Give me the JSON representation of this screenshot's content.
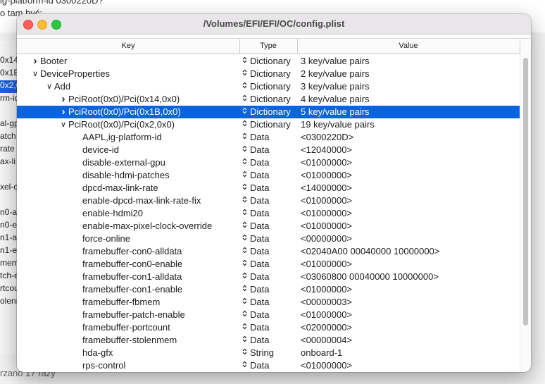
{
  "background": {
    "top_lines": [
      "ig-platform-id 0300220D?",
      "o tam być:"
    ],
    "fragments": [
      "0x14",
      "0x1B",
      "0x2,0",
      "rm-id",
      "",
      "al-gp",
      "atch",
      "rate",
      "ax-li",
      "",
      "xel-c",
      "",
      "n0-a",
      "n0-e",
      "n1-a",
      "n1-e",
      "mem",
      "tch-e",
      "rtcou",
      "olenm"
    ],
    "bottom_text": "rzano 17 razy"
  },
  "window": {
    "title": "/Volumes/EFI/EFI/OC/config.plist",
    "columns": {
      "key": "Key",
      "type": "Type",
      "value": "Value"
    },
    "rows": [
      {
        "key": "Booter",
        "type": "Dictionary",
        "value": "3 key/value pairs",
        "level": 0,
        "disclosure": ">",
        "selected": false
      },
      {
        "key": "DeviceProperties",
        "type": "Dictionary",
        "value": "2 key/value pairs",
        "level": 0,
        "disclosure": "v",
        "selected": false
      },
      {
        "key": "Add",
        "type": "Dictionary",
        "value": "3 key/value pairs",
        "level": 1,
        "disclosure": "v",
        "selected": false
      },
      {
        "key": "PciRoot(0x0)/Pci(0x14,0x0)",
        "type": "Dictionary",
        "value": "4 key/value pairs",
        "level": 2,
        "disclosure": ">",
        "selected": false
      },
      {
        "key": "PciRoot(0x0)/Pci(0x1B,0x0)",
        "type": "Dictionary",
        "value": "5 key/value pairs",
        "level": 2,
        "disclosure": ">",
        "selected": true
      },
      {
        "key": "PciRoot(0x0)/Pci(0x2,0x0)",
        "type": "Dictionary",
        "value": "19 key/value pairs",
        "level": 2,
        "disclosure": "v",
        "selected": false
      },
      {
        "key": "AAPL,ig-platform-id",
        "type": "Data",
        "value": "<0300220D>",
        "level": 3,
        "disclosure": "",
        "selected": false
      },
      {
        "key": "device-id",
        "type": "Data",
        "value": "<12040000>",
        "level": 3,
        "disclosure": "",
        "selected": false
      },
      {
        "key": "disable-external-gpu",
        "type": "Data",
        "value": "<01000000>",
        "level": 3,
        "disclosure": "",
        "selected": false
      },
      {
        "key": "disable-hdmi-patches",
        "type": "Data",
        "value": "<01000000>",
        "level": 3,
        "disclosure": "",
        "selected": false
      },
      {
        "key": "dpcd-max-link-rate",
        "type": "Data",
        "value": "<14000000>",
        "level": 3,
        "disclosure": "",
        "selected": false
      },
      {
        "key": "enable-dpcd-max-link-rate-fix",
        "type": "Data",
        "value": "<01000000>",
        "level": 3,
        "disclosure": "",
        "selected": false
      },
      {
        "key": "enable-hdmi20",
        "type": "Data",
        "value": "<01000000>",
        "level": 3,
        "disclosure": "",
        "selected": false
      },
      {
        "key": "enable-max-pixel-clock-override",
        "type": "Data",
        "value": "<01000000>",
        "level": 3,
        "disclosure": "",
        "selected": false
      },
      {
        "key": "force-online",
        "type": "Data",
        "value": "<00000000>",
        "level": 3,
        "disclosure": "",
        "selected": false
      },
      {
        "key": "framebuffer-con0-alldata",
        "type": "Data",
        "value": "<02040A00 00040000 10000000>",
        "level": 3,
        "disclosure": "",
        "selected": false
      },
      {
        "key": "framebuffer-con0-enable",
        "type": "Data",
        "value": "<01000000>",
        "level": 3,
        "disclosure": "",
        "selected": false
      },
      {
        "key": "framebuffer-con1-alldata",
        "type": "Data",
        "value": "<03060800 00040000 10000000>",
        "level": 3,
        "disclosure": "",
        "selected": false
      },
      {
        "key": "framebuffer-con1-enable",
        "type": "Data",
        "value": "<01000000>",
        "level": 3,
        "disclosure": "",
        "selected": false
      },
      {
        "key": "framebuffer-fbmem",
        "type": "Data",
        "value": "<00000003>",
        "level": 3,
        "disclosure": "",
        "selected": false
      },
      {
        "key": "framebuffer-patch-enable",
        "type": "Data",
        "value": "<01000000>",
        "level": 3,
        "disclosure": "",
        "selected": false
      },
      {
        "key": "framebuffer-portcount",
        "type": "Data",
        "value": "<02000000>",
        "level": 3,
        "disclosure": "",
        "selected": false
      },
      {
        "key": "framebuffer-stolenmem",
        "type": "Data",
        "value": "<00000004>",
        "level": 3,
        "disclosure": "",
        "selected": false
      },
      {
        "key": "hda-gfx",
        "type": "String",
        "value": "onboard-1",
        "level": 3,
        "disclosure": "",
        "selected": false
      },
      {
        "key": "rps-control",
        "type": "Data",
        "value": "<01000000>",
        "level": 3,
        "disclosure": "",
        "selected": false
      }
    ]
  },
  "colors": {
    "selection": "#0a64e0",
    "close": "#fe5f57",
    "minimize": "#febc2e",
    "zoom": "#28c840"
  },
  "icons": {
    "updown": "updown-chevron-icon",
    "expanded": "disclosure-expanded-icon",
    "collapsed": "disclosure-collapsed-icon"
  }
}
